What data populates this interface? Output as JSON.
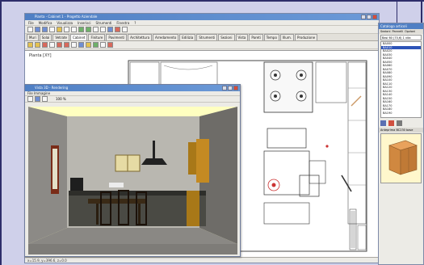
{
  "main_window": {
    "title": "Pianta - Cabinet 1 - Progetto Aziendale",
    "menu": [
      "File",
      "Modifica",
      "Visualizza",
      "Inserisci",
      "Strumenti",
      "Finestra",
      "?"
    ],
    "tabs": [
      "Muri",
      "Solai",
      "Vetrate",
      "Cabinet",
      "Finiture",
      "Pavimenti",
      "Architettura",
      "Arredamento",
      "Edilizia",
      "Strumenti",
      "Sezioni",
      "Vista",
      "Pareti",
      "Tempo",
      "Illum.",
      "Produzione"
    ],
    "active_tab_index": 3,
    "plan_label": "Pianta [XY]",
    "status_text": "x=15.9, y=396.6, z=0.0"
  },
  "view3d_window": {
    "title": "Vista 3D - Rendering",
    "menu": "File   Immagine",
    "toolbar_value": "100 %"
  },
  "catalog_panel": {
    "title": "Catalogo articoli",
    "tabs": [
      "Sezioni",
      "Pannelli",
      "Opzioni"
    ],
    "selected_option": "Basi 60 (70,6) 1 vita",
    "items": [
      "BA000",
      "BA010",
      "BA020",
      "BA030",
      "BA040",
      "BA050",
      "BA060",
      "BA070",
      "BA080",
      "BA090",
      "BA100",
      "BA110",
      "BA120",
      "BA130",
      "BA140",
      "BA150",
      "BA160",
      "BA170",
      "BA180",
      "BA190"
    ],
    "selected_index": 1,
    "preview_caption": "Anteprima  BC230 base"
  },
  "colors": {
    "title_gradient": "#4f7fc4",
    "scene_background": "#ffffc0",
    "frame_accent": "#2d2d6a"
  }
}
